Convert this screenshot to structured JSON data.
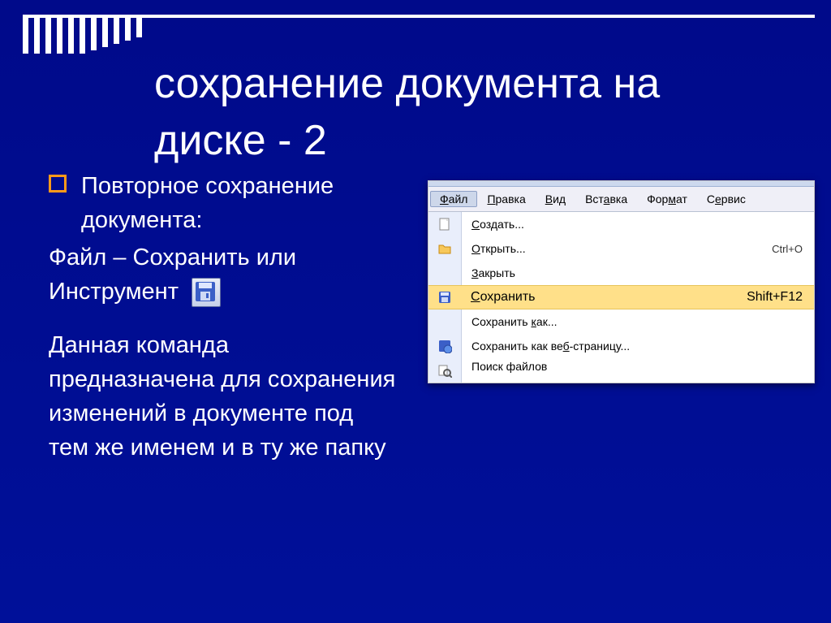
{
  "title_line1": "сохранение документа на",
  "title_line2": "диске - 2",
  "bullet1": "Повторное сохранение документа:",
  "line_file_save": "Файл – Сохранить или",
  "line_tool": "Инструмент",
  "para": "Данная команда предназначена для сохранения изменений в документе под тем же именем и в ту же папку",
  "menubar": {
    "file": "Файл",
    "edit": "Правка",
    "view": "Вид",
    "insert": "Вставка",
    "format": "Формат",
    "service": "Сервис"
  },
  "menu_items": {
    "create": "Создать...",
    "open": "Открыть...",
    "open_short": "Ctrl+O",
    "close": "Закрыть",
    "save": "Сохранить",
    "save_short": "Shift+F12",
    "save_as": "Сохранить как...",
    "save_as_web": "Сохранить как веб-страницу...",
    "find_files": "Поиск файлов"
  }
}
